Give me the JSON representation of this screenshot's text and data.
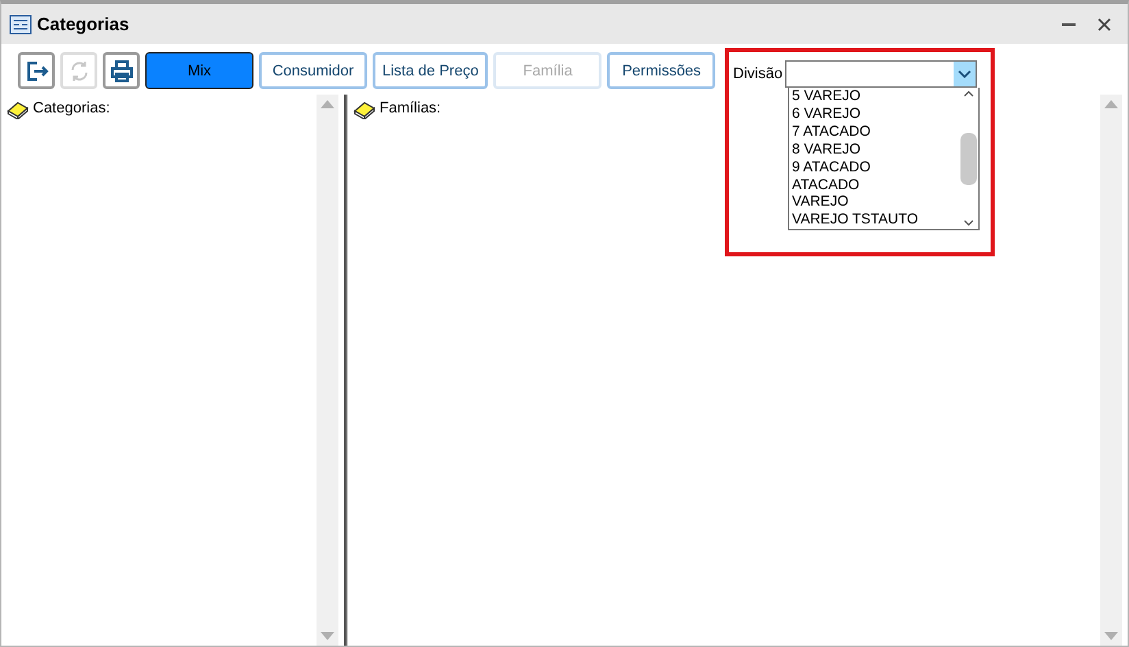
{
  "window": {
    "title": "Categorias"
  },
  "toolbar_icons": [
    {
      "kind": "exit",
      "disabled": false
    },
    {
      "kind": "refresh",
      "disabled": true
    },
    {
      "kind": "print",
      "disabled": false
    }
  ],
  "buttons": [
    {
      "label": "Mix",
      "selected": true,
      "disabled": false
    },
    {
      "label": "Consumidor",
      "selected": false,
      "disabled": false
    },
    {
      "label": "Lista de Preço",
      "selected": false,
      "disabled": false
    },
    {
      "label": "Família",
      "selected": false,
      "disabled": true
    },
    {
      "label": "Permissões",
      "selected": false,
      "disabled": false
    }
  ],
  "division": {
    "label": "Divisão",
    "expanded": true,
    "options": [
      "5 VAREJO",
      "6 VAREJO",
      "7 ATACADO",
      "8 VAREJO",
      "9 ATACADO",
      "ATACADO",
      "VAREJO",
      "VAREJO TSTAUTO"
    ]
  },
  "panels": [
    {
      "label": "Categorias:"
    },
    {
      "label": "Famílias:"
    }
  ]
}
